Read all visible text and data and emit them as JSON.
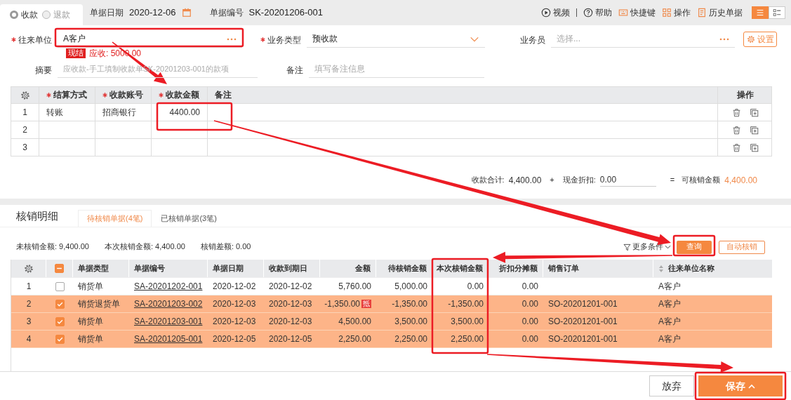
{
  "header": {
    "direction": [
      {
        "label": "收款",
        "selected": true
      },
      {
        "label": "退款",
        "selected": false
      }
    ],
    "date_label": "单据日期",
    "date": "2020-12-06",
    "number_label": "单据编号",
    "number": "SK-20201206-001",
    "links": [
      {
        "label": "视频",
        "kind": "video"
      },
      {
        "label": "帮助",
        "kind": "help"
      },
      {
        "label": "快捷键",
        "kind": "keyboard"
      },
      {
        "label": "操作",
        "kind": "actions"
      },
      {
        "label": "历史单据",
        "kind": "history"
      }
    ],
    "views": [
      {
        "kind": "list",
        "selected": true
      },
      {
        "kind": "detail",
        "selected": false
      }
    ]
  },
  "form": {
    "partner": {
      "label": "往来单位",
      "required": true,
      "value": "A客户"
    },
    "settlement_tag": "现结",
    "receivable": "应收: 5000.00",
    "business_type": {
      "label": "业务类型",
      "required": true,
      "value": "预收款"
    },
    "salesperson": {
      "label": "业务员",
      "required": false,
      "placeholder": "选择..."
    },
    "settings_button": "设置",
    "summary": {
      "label": "摘要",
      "placeholder": "应收款-手工填制收款单SK-20201203-001的款项"
    },
    "remark": {
      "label": "备注",
      "placeholder": "填写备注信息"
    }
  },
  "payment_table": {
    "columns": [
      {
        "label": "结算方式",
        "required": true
      },
      {
        "label": "收款账号",
        "required": true
      },
      {
        "label": "收款金额",
        "required": true
      },
      {
        "label": "备注",
        "required": false
      }
    ],
    "actions_label": "操作",
    "rows": [
      {
        "index": "1",
        "method": "转账",
        "account": "招商银行",
        "amount": "4400.00"
      },
      {
        "index": "2"
      },
      {
        "index": "3"
      }
    ]
  },
  "totals": {
    "receipt_label": "收款合计:",
    "receipt": "4,400.00",
    "plus": "+",
    "discount_label": "现金折扣:",
    "discount": "0.00",
    "equals": "=",
    "available_label": "可核销金额",
    "available": "4,400.00"
  },
  "writeoff": {
    "title": "核销明细",
    "tabs": [
      {
        "label": "待核销单据(4笔)",
        "selected": true
      },
      {
        "label": "已核销单据(3笔)",
        "selected": false
      }
    ],
    "summary": [
      "未核销金额: 9,400.00",
      "本次核销金额: 4,400.00",
      "核销差额: 0.00"
    ],
    "more_conditions": "更多条件",
    "query_button": "查询",
    "auto_button": "自动核销",
    "table": {
      "select_all": {
        "checked": true,
        "indeterminate": true
      },
      "columns": [
        {
          "label": "单据类型"
        },
        {
          "label": "单据编号"
        },
        {
          "label": "单据日期"
        },
        {
          "label": "收款到期日"
        },
        {
          "label": "金额"
        },
        {
          "label": "待核销金额"
        },
        {
          "label": "本次核销金额"
        },
        {
          "label": "折扣分摊额"
        },
        {
          "label": "销售订单"
        },
        {
          "label": "往来单位名称",
          "sortable": true
        }
      ],
      "rows": [
        {
          "index": "1",
          "selected": false,
          "type": "销货单",
          "number": "SA-20201202-001",
          "date": "2020-12-02",
          "due": "2020-12-02",
          "amount": "5,760.00",
          "pending": "5,000.00",
          "this": "0.00",
          "discount": "0.00",
          "partner": "A客户"
        },
        {
          "index": "2",
          "selected": true,
          "type": "销货退货单",
          "number": "SA-20201203-002",
          "date": "2020-12-03",
          "due": "2020-12-03",
          "amount": "-1,350.00",
          "offset_tag": "抵",
          "pending": "-1,350.00",
          "this": "-1,350.00",
          "discount": "0.00",
          "order": "SO-20201201-001",
          "partner": "A客户"
        },
        {
          "index": "3",
          "selected": true,
          "type": "销货单",
          "number": "SA-20201203-001",
          "date": "2020-12-03",
          "due": "2020-12-03",
          "amount": "4,500.00",
          "pending": "3,500.00",
          "this": "3,500.00",
          "discount": "0.00",
          "order": "SO-20201201-001",
          "partner": "A客户"
        },
        {
          "index": "4",
          "selected": true,
          "type": "销货单",
          "number": "SA-20201205-001",
          "date": "2020-12-05",
          "due": "2020-12-05",
          "amount": "2,250.00",
          "pending": "2,250.00",
          "this": "2,250.00",
          "discount": "0.00",
          "order": "SO-20201201-001",
          "partner": "A客户"
        }
      ]
    }
  },
  "footer": {
    "buttons": [
      {
        "label": "放弃",
        "kind": "secondary"
      },
      {
        "label": "保存",
        "kind": "primary"
      }
    ]
  }
}
